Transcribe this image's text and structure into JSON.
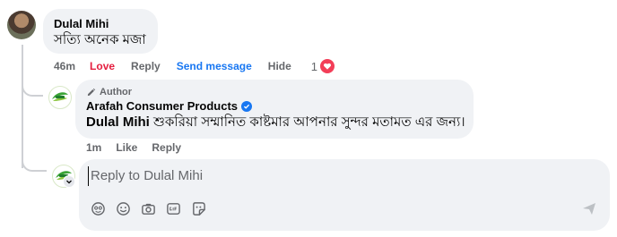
{
  "comment": {
    "author": "Dulal Mihi",
    "text": "সত্যি অনেক মজা",
    "actions": {
      "time": "46m",
      "love": "Love",
      "reply": "Reply",
      "send_message": "Send message",
      "hide": "Hide"
    },
    "reaction_count": "1",
    "reaction_icon": "heart-icon"
  },
  "reply": {
    "author_tag": "Author",
    "author_tag_icon": "pencil-icon",
    "page_name": "Arafah Consumer Products",
    "verified_icon": "verified-badge-icon",
    "mention": "Dulal Mihi",
    "text": " শুকরিয়া সম্মানিত কাষ্টমার আপনার সুন্দর মতামত এর জন্য।",
    "actions": {
      "time": "1m",
      "like": "Like",
      "reply": "Reply"
    }
  },
  "reply_box": {
    "placeholder": "Reply to Dulal Mihi",
    "tools": [
      "avatar-sticker-icon",
      "emoji-icon",
      "camera-icon",
      "gif-icon",
      "sticker-icon"
    ],
    "send_icon": "send-icon"
  },
  "colors": {
    "bubble_bg": "#f0f2f5",
    "love_red": "#e41e3f",
    "link_blue": "#1877f2",
    "muted": "#65676b"
  }
}
